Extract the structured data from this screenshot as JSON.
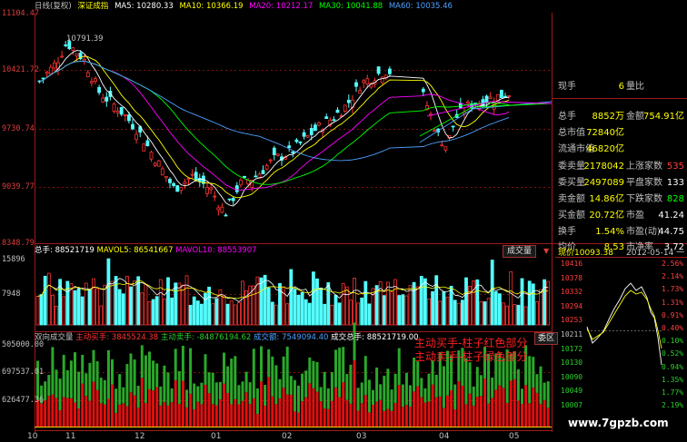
{
  "header": {
    "chart_type_label": "日线(复权)",
    "index_name": "深证成指",
    "ma5": "MA5: 10280.33",
    "ma10": "MA10: 10366.19",
    "ma20": "MA20: 10212.17",
    "ma30": "MA30: 10041.88",
    "ma60": "MA60: 10035.46"
  },
  "price_axis": [
    "11104.47",
    "10421.72",
    "9730.74",
    "9039.77",
    "8348.79"
  ],
  "high_marker": "10791.39",
  "volume_panel": {
    "legend_total": "总手: 88521719",
    "legend_mavol5": "MAVOL5: 86541667",
    "legend_mavol10": "MAVOL10: 88553907",
    "tag": "成交量",
    "axis": [
      "15896",
      "7948"
    ]
  },
  "flow_panel": {
    "title": "双向成交量",
    "active_buy": "主动买手: 3845524.38",
    "active_sell": "主动卖手: -84876194.62",
    "direction": "成交额: 7549094.40",
    "total": "成交总手: 88521719.00",
    "tag": "委区",
    "axis": [
      "505000.00",
      "697537.01",
      "626477.36"
    ],
    "annotation_line1": "主动买手-柱子红色部分",
    "annotation_line2": "主动卖手-柱子绿色部分"
  },
  "x_axis": [
    "10",
    "11",
    "12",
    "01",
    "02",
    "03",
    "04",
    "05"
  ],
  "right_panel": {
    "rows": [
      {
        "k": "现手",
        "v": "6",
        "k2": "量比",
        "v2": ""
      },
      {
        "k": "总手",
        "v": "8852万",
        "k2": "金额",
        "v2": "754.91亿"
      },
      {
        "k": "总市值",
        "v": "72840亿",
        "k2": "",
        "v2": ""
      },
      {
        "k": "流通市值",
        "v": "46820亿",
        "k2": "",
        "v2": ""
      },
      {
        "k": "委卖量",
        "v": "2178042",
        "k2": "上涨家数",
        "v2": "535"
      },
      {
        "k": "委买量",
        "v": "2497089",
        "k2": "平盘家数",
        "v2": "133"
      },
      {
        "k": "卖金额",
        "v": "14.86亿",
        "k2": "下跌家数",
        "v2": "828"
      },
      {
        "k": "买金额",
        "v": "20.72亿",
        "k2": "市盈",
        "v2": "41.24"
      },
      {
        "k": "换手",
        "v": "1.54%",
        "k2": "市盈(动)",
        "v2": "44.75"
      },
      {
        "k": "均价",
        "v": "8.53",
        "k2": "市净率",
        "v2": "3.72"
      }
    ],
    "mini_title": "现价10093.38",
    "mini_date": "2012-05-14 一",
    "mini_left_axis": [
      "10416",
      "10378",
      "10332",
      "10294",
      "10253",
      "10211",
      "10172",
      "10130",
      "10090",
      "10049",
      "10007"
    ],
    "mini_right_axis": [
      "2.56%",
      "2.14%",
      "1.73%",
      "1.31%",
      "0.91%",
      "0.40%",
      "0.10%",
      "0.52%",
      "0.94%",
      "1.35%",
      "1.77%",
      "2.19%"
    ]
  },
  "watermark": "www.7gpzb.com",
  "colors": {
    "up": "#ff3232",
    "down": "#54ffff",
    "buy": "#e01010",
    "sell": "#2aa82a",
    "ma5": "#ffffff",
    "ma10": "#ffff00",
    "ma20": "#ff00ff",
    "ma30": "#00ff00",
    "ma60": "#4aa0ff",
    "grid": "#801010"
  },
  "chart_data": {
    "type": "candlestick",
    "ylim": [
      8348.79,
      11104.47
    ],
    "high": 10791.39,
    "x_ticks": [
      "10",
      "11",
      "12",
      "01",
      "02",
      "03",
      "04",
      "05"
    ]
  }
}
